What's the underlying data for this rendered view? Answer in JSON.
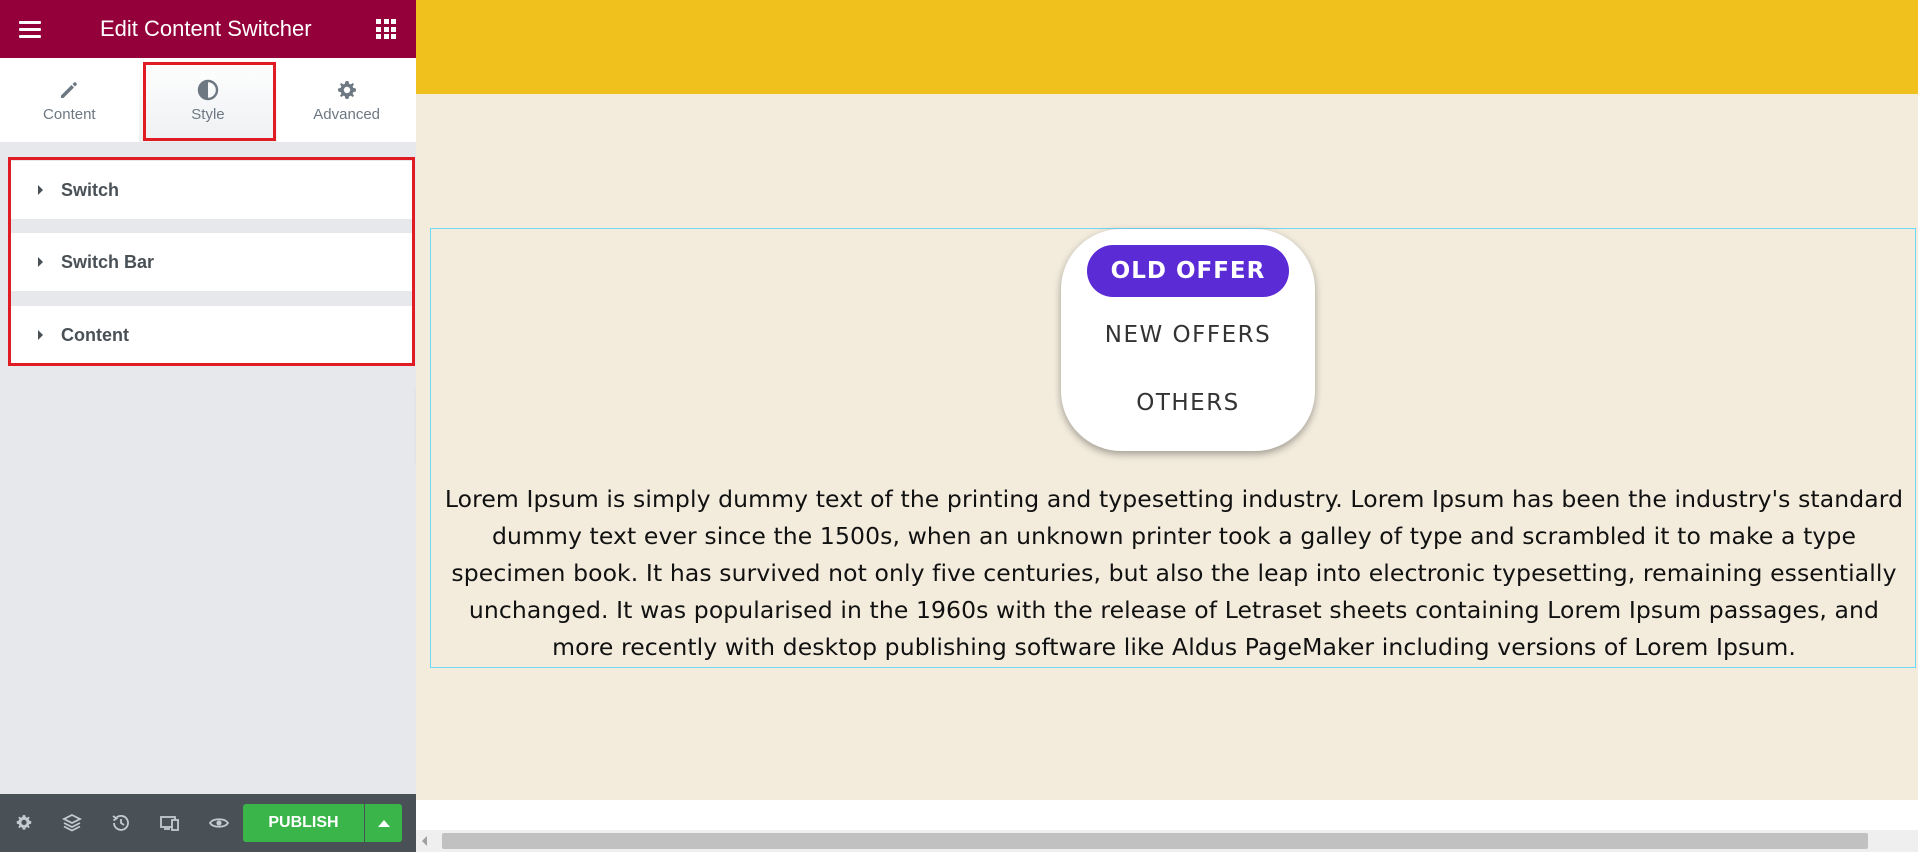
{
  "panel": {
    "title": "Edit Content Switcher",
    "tabs": [
      {
        "label": "Content",
        "icon": "pencil-icon",
        "active": false
      },
      {
        "label": "Style",
        "icon": "half-circle-icon",
        "active": true
      },
      {
        "label": "Advanced",
        "icon": "gear-icon",
        "active": false
      }
    ],
    "sections": [
      {
        "label": "Switch"
      },
      {
        "label": "Switch Bar"
      },
      {
        "label": "Content"
      }
    ],
    "footer": {
      "icons": [
        "settings-icon",
        "layers-icon",
        "history-icon",
        "responsive-icon",
        "preview-eye-icon"
      ],
      "publish_label": "PUBLISH"
    }
  },
  "preview": {
    "switcher": {
      "items": [
        "OLD OFFER",
        "NEW OFFERS",
        "OTHERS"
      ],
      "active_index": 0,
      "active_color": "#5b2bd6"
    },
    "body_text": "Lorem Ipsum is simply dummy text of the printing and typesetting industry. Lorem Ipsum has been the industry's standard dummy text ever since the 1500s, when an unknown printer took a galley of type and scrambled it to make a type specimen book. It has survived not only five centuries, but also the leap into electronic typesetting, remaining essentially unchanged. It was popularised in the 1960s with the release of Letraset sheets containing Lorem Ipsum passages, and more recently with desktop publishing software like Aldus PageMaker including versions of Lorem Ipsum."
  },
  "colors": {
    "header_bg": "#93003a",
    "top_band": "#f0c01c",
    "canvas_bg": "#f3ecdd",
    "publish_green": "#39b54a",
    "highlight_red": "#e01b24"
  }
}
